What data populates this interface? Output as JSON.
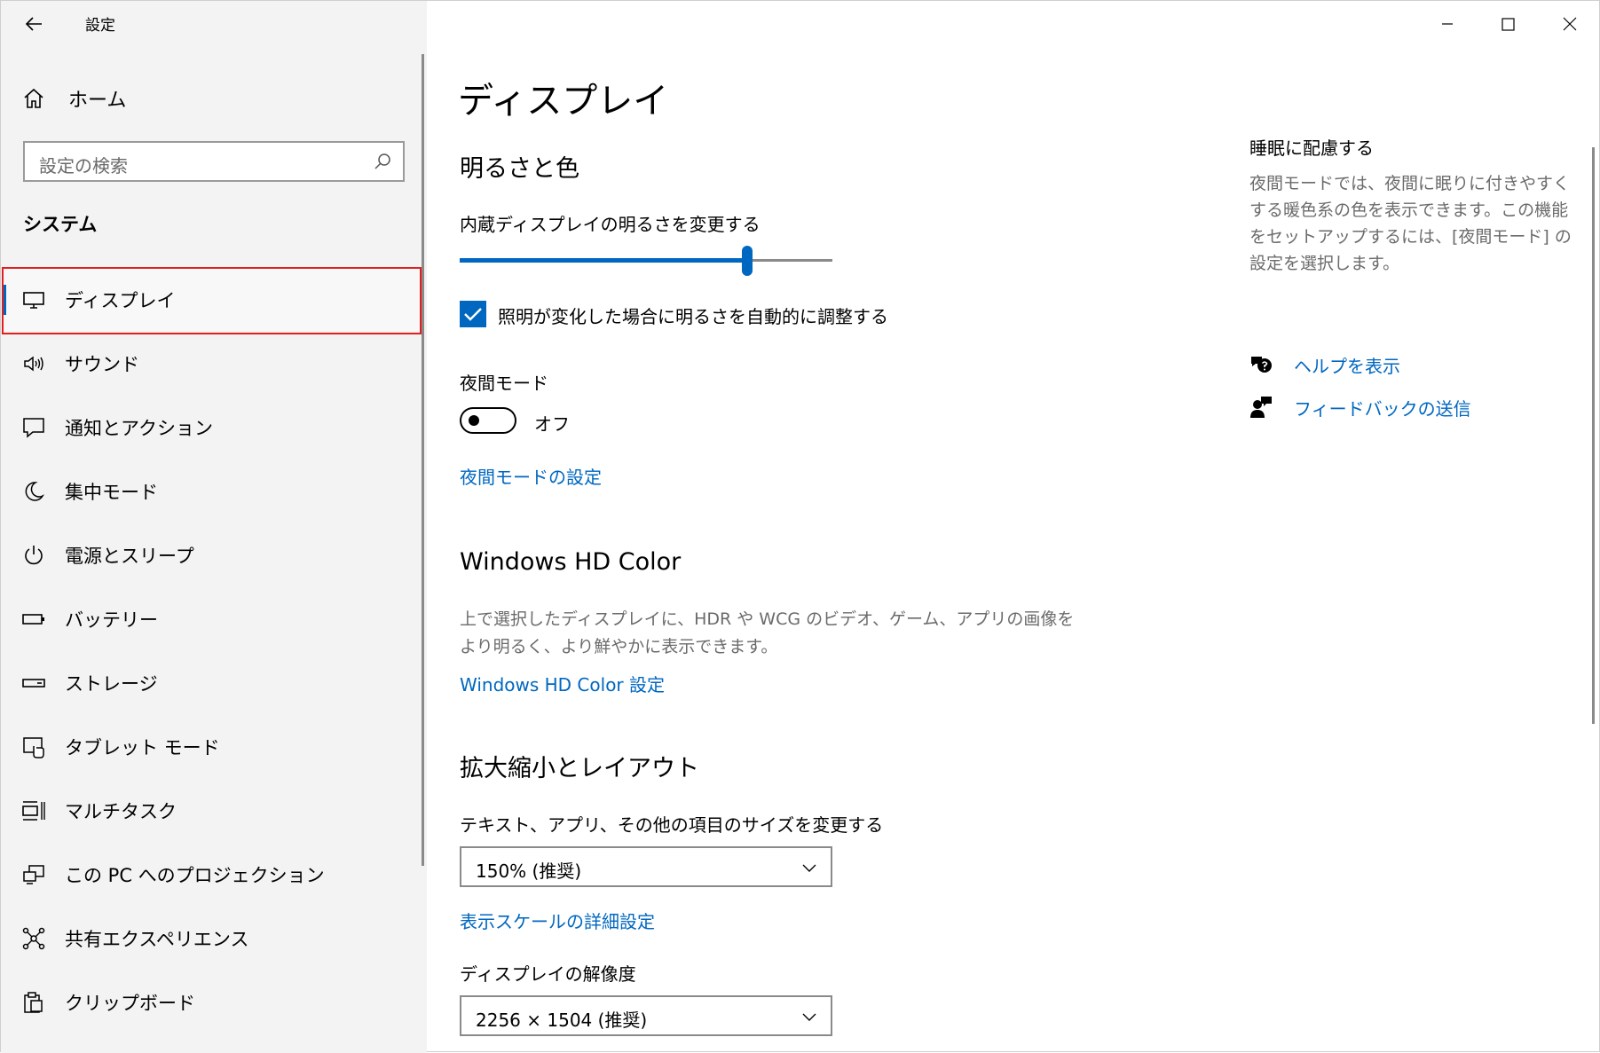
{
  "app": {
    "title": "設定"
  },
  "sidebar": {
    "home_label": "ホーム",
    "search_placeholder": "設定の検索",
    "section_title": "システム",
    "items": [
      {
        "label": "ディスプレイ",
        "icon": "monitor-icon",
        "selected": true
      },
      {
        "label": "サウンド",
        "icon": "speaker-icon"
      },
      {
        "label": "通知とアクション",
        "icon": "notification-icon"
      },
      {
        "label": "集中モード",
        "icon": "moon-icon"
      },
      {
        "label": "電源とスリープ",
        "icon": "power-icon"
      },
      {
        "label": "バッテリー",
        "icon": "battery-icon"
      },
      {
        "label": "ストレージ",
        "icon": "storage-icon"
      },
      {
        "label": "タブレット モード",
        "icon": "tablet-icon"
      },
      {
        "label": "マルチタスク",
        "icon": "multitask-icon"
      },
      {
        "label": "この PC へのプロジェクション",
        "icon": "projection-icon"
      },
      {
        "label": "共有エクスペリエンス",
        "icon": "share-icon"
      },
      {
        "label": "クリップボード",
        "icon": "clipboard-icon"
      }
    ]
  },
  "main": {
    "page_title": "ディスプレイ",
    "brightness": {
      "heading": "明るさと色",
      "slider_label": "内蔵ディスプレイの明るさを変更する",
      "slider_value": 0.78,
      "auto_checkbox_label": "照明が変化した場合に明るさを自動的に調整する",
      "auto_checked": true
    },
    "night_mode": {
      "label": "夜間モード",
      "toggle_state": "オフ",
      "settings_link": "夜間モードの設定"
    },
    "hd_color": {
      "heading": "Windows HD Color",
      "description_line1": "上で選択したディスプレイに、HDR や WCG のビデオ、ゲーム、アプリの画像を",
      "description_line2": "より明るく、より鮮やかに表示できます。",
      "link": "Windows HD Color 設定"
    },
    "scale_layout": {
      "heading": "拡大縮小とレイアウト",
      "scale_label": "テキスト、アプリ、その他の項目のサイズを変更する",
      "scale_value": "150% (推奨)",
      "advanced_link": "表示スケールの詳細設定",
      "resolution_label": "ディスプレイの解像度",
      "resolution_value": "2256 × 1504 (推奨)"
    }
  },
  "side_panel": {
    "heading": "睡眠に配慮する",
    "description": "夜間モードでは、夜間に眠りに付きやすくする暖色系の色を表示できます。この機能をセットアップするには、[夜間モード] の設定を選択します。",
    "help_link": "ヘルプを表示",
    "feedback_link": "フィードバックの送信"
  },
  "colors": {
    "accent": "#0067c0",
    "highlight_border": "#e02020",
    "sidebar_bg": "#f3f3f3"
  }
}
